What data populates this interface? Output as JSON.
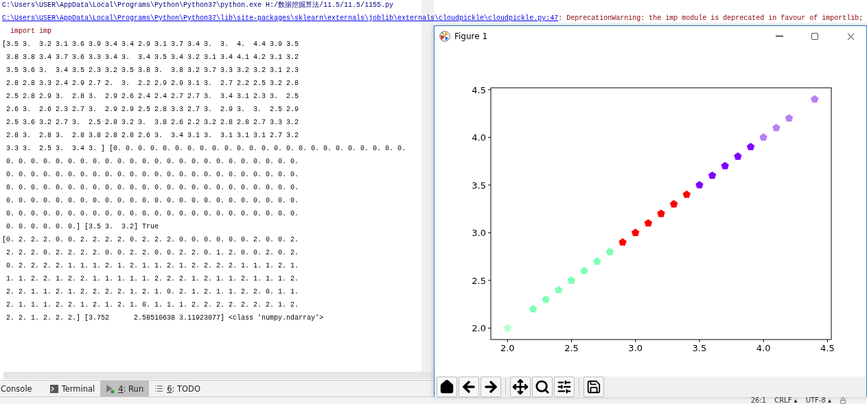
{
  "console": {
    "lines": [
      {
        "kind": "command",
        "text": "C:\\Users\\USER\\AppData\\Local\\Programs\\Python\\Python37\\python.exe H:/数据挖掘算法/11.5/11.5/1155.py"
      },
      {
        "kind": "warning",
        "link": "C:\\Users\\USER\\AppData\\Local\\Programs\\Python\\Python37\\lib\\site-packages\\sklearn\\externals\\joblib\\externals\\cloudpickle\\cloudpickle.py:47",
        "text": ": DeprecationWarning: the imp module is deprecated in favour of importlib;"
      },
      {
        "kind": "error",
        "text": "  import imp"
      },
      {
        "kind": "output",
        "text": "[3.5 3.  3.2 3.1 3.6 3.9 3.4 3.4 2.9 3.1 3.7 3.4 3.  3.  4.  4.4 3.9 3.5"
      },
      {
        "kind": "output",
        "text": " 3.8 3.8 3.4 3.7 3.6 3.3 3.4 3.  3.4 3.5 3.4 3.2 3.1 3.4 4.1 4.2 3.1 3.2"
      },
      {
        "kind": "output",
        "text": " 3.5 3.6 3.  3.4 3.5 2.3 3.2 3.5 3.8 3.  3.8 3.2 3.7 3.3 3.2 3.2 3.1 2.3"
      },
      {
        "kind": "output",
        "text": " 2.8 2.8 3.3 2.4 2.9 2.7 2.  3.  2.2 2.9 2.9 3.1 3.  2.7 2.2 2.5 3.2 2.8"
      },
      {
        "kind": "output",
        "text": " 2.5 2.8 2.9 3.  2.8 3.  2.9 2.6 2.4 2.4 2.7 2.7 3.  3.4 3.1 2.3 3.  2.5"
      },
      {
        "kind": "output",
        "text": " 2.6 3.  2.6 2.3 2.7 3.  2.9 2.9 2.5 2.8 3.3 2.7 3.  2.9 3.  3.  2.5 2.9"
      },
      {
        "kind": "output",
        "text": " 2.5 3.6 3.2 2.7 3.  2.5 2.8 3.2 3.  3.8 2.6 2.2 3.2 2.8 2.8 2.7 3.3 3.2"
      },
      {
        "kind": "output",
        "text": " 2.8 3.  2.8 3.  2.8 3.8 2.8 2.8 2.6 3.  3.4 3.1 3.  3.1 3.1 3.1 2.7 3.2"
      },
      {
        "kind": "output",
        "text": " 3.3 3.  2.5 3.  3.4 3. ] [0. 0. 0. 0. 0. 0. 0. 0. 0. 0. 0. 0. 0. 0. 0. 0. 0. 0. 0. 0. 0. 0. 0. 0."
      },
      {
        "kind": "output",
        "text": " 0. 0. 0. 0. 0. 0. 0. 0. 0. 0. 0. 0. 0. 0. 0. 0. 0. 0. 0. 0. 0. 0. 0. 0."
      },
      {
        "kind": "output",
        "text": " 0. 0. 0. 0. 0. 0. 0. 0. 0. 0. 0. 0. 0. 0. 0. 0. 0. 0. 0. 0. 0. 0. 0. 0."
      },
      {
        "kind": "output",
        "text": " 0. 0. 0. 0. 0. 0. 0. 0. 0. 0. 0. 0. 0. 0. 0. 0. 0. 0. 0. 0. 0. 0. 0. 0."
      },
      {
        "kind": "output",
        "text": " 0. 0. 0. 0. 0. 0. 0. 0. 0. 0. 0. 0. 0. 0. 0. 0. 0. 0. 0. 0. 0. 0. 0. 0."
      },
      {
        "kind": "output",
        "text": " 0. 0. 0. 0. 0. 0. 0. 0. 0. 0. 0. 0. 0. 0. 0. 0. 0. 0. 0. 0. 0. 0. 0. 0."
      },
      {
        "kind": "output",
        "text": " 0. 0. 0. 0. 0. 0.] [3.5 3.  3.2] True"
      },
      {
        "kind": "output",
        "text": "[0. 2. 2. 2. 0. 0. 2. 2. 2. 2. 0. 2. 2. 2. 0. 0. 0. 0. 0. 0. 2. 0. 0. 2."
      },
      {
        "kind": "output",
        "text": " 2. 2. 2. 0. 2. 2. 2. 2. 0. 0. 2. 2. 0. 0. 2. 2. 0. 1. 2. 0. 0. 2. 0. 2."
      },
      {
        "kind": "output",
        "text": " 0. 2. 2. 2. 2. 1. 1. 1. 2. 1. 2. 1. 1. 2. 1. 2. 2. 2. 2. 1. 1. 1. 2. 1."
      },
      {
        "kind": "output",
        "text": " 1. 1. 2. 2. 1. 2. 2. 1. 1. 1. 1. 1. 2. 2. 2. 1. 2. 1. 1. 2. 1. 1. 1. 2."
      },
      {
        "kind": "output",
        "text": " 2. 2. 1. 1. 2. 1. 2. 2. 2. 2. 1. 2. 1. 0. 2. 1. 2. 1. 1. 2. 2. 0. 1. 1."
      },
      {
        "kind": "output",
        "text": " 2. 1. 1. 1. 2. 2. 1. 2. 1. 2. 1. 0. 1. 1. 1. 2. 2. 2. 2. 2. 2. 2. 1. 2."
      },
      {
        "kind": "output",
        "text": " 2. 2. 1. 2. 2. 2.] [3.752      2.58510638 3.11923077] <class 'numpy.ndarray'>"
      }
    ]
  },
  "figure_window": {
    "title": "Figure 1",
    "chart_data": {
      "type": "scatter",
      "x": [
        2.0,
        2.2,
        2.3,
        2.4,
        2.5,
        2.6,
        2.7,
        2.8,
        2.9,
        3.0,
        3.1,
        3.2,
        3.3,
        3.4,
        3.5,
        3.6,
        3.7,
        3.8,
        3.9,
        4.0,
        4.1,
        4.2,
        4.4
      ],
      "series": [
        {
          "color": "#b4ffd2",
          "values": [
            2.0,
            null,
            null,
            null,
            null,
            null,
            null,
            null,
            null,
            null,
            null,
            null,
            null,
            null,
            null,
            null,
            null,
            null,
            null,
            null,
            null,
            null,
            null
          ]
        },
        {
          "color": "#80ffb4",
          "values": [
            null,
            2.2,
            2.3,
            2.4,
            2.5,
            2.6,
            2.7,
            2.8,
            null,
            null,
            null,
            null,
            null,
            null,
            null,
            null,
            null,
            null,
            null,
            null,
            null,
            null,
            null
          ]
        },
        {
          "color": "#ff0000",
          "values": [
            null,
            null,
            null,
            null,
            null,
            null,
            null,
            null,
            2.9,
            3.0,
            3.1,
            3.2,
            3.3,
            3.4,
            null,
            null,
            null,
            null,
            null,
            null,
            null,
            null,
            null
          ]
        },
        {
          "color": "#8000ff",
          "values": [
            null,
            null,
            null,
            null,
            null,
            null,
            null,
            null,
            null,
            null,
            null,
            null,
            null,
            null,
            3.5,
            3.6,
            3.7,
            3.8,
            3.9,
            null,
            null,
            null,
            null
          ]
        },
        {
          "color": "#b87ff7",
          "values": [
            null,
            null,
            null,
            null,
            null,
            null,
            null,
            null,
            null,
            null,
            null,
            null,
            null,
            null,
            null,
            null,
            null,
            null,
            null,
            4.0,
            4.1,
            4.2,
            4.4
          ]
        }
      ],
      "xlim": [
        1.87,
        4.53
      ],
      "ylim": [
        1.88,
        4.52
      ],
      "xticks": [
        {
          "value": 2.0,
          "label": "2.0"
        },
        {
          "value": 2.5,
          "label": "2.5"
        },
        {
          "value": 3.0,
          "label": "3.0"
        },
        {
          "value": 3.5,
          "label": "3.5"
        },
        {
          "value": 4.0,
          "label": "4.0"
        },
        {
          "value": 4.5,
          "label": "4.5"
        }
      ],
      "yticks": [
        {
          "value": 2.0,
          "label": "2.0"
        },
        {
          "value": 2.5,
          "label": "2.5"
        },
        {
          "value": 3.0,
          "label": "3.0"
        },
        {
          "value": 3.5,
          "label": "3.5"
        },
        {
          "value": 4.0,
          "label": "4.0"
        },
        {
          "value": 4.5,
          "label": "4.5"
        }
      ]
    }
  },
  "tool_tabs": [
    {
      "kind": "plain",
      "label": "Console",
      "selected": false
    },
    {
      "kind": "terminal",
      "label": "Terminal",
      "selected": false
    },
    {
      "kind": "run",
      "mnemonic": "4",
      "label": ": Run",
      "selected": true
    },
    {
      "kind": "todo",
      "mnemonic": "6",
      "label": ": TODO",
      "selected": false
    }
  ],
  "status_bar": [
    {
      "text": "26:1"
    },
    {
      "text": "CRLF ▴"
    },
    {
      "text": "UTF-8 ▴"
    }
  ]
}
